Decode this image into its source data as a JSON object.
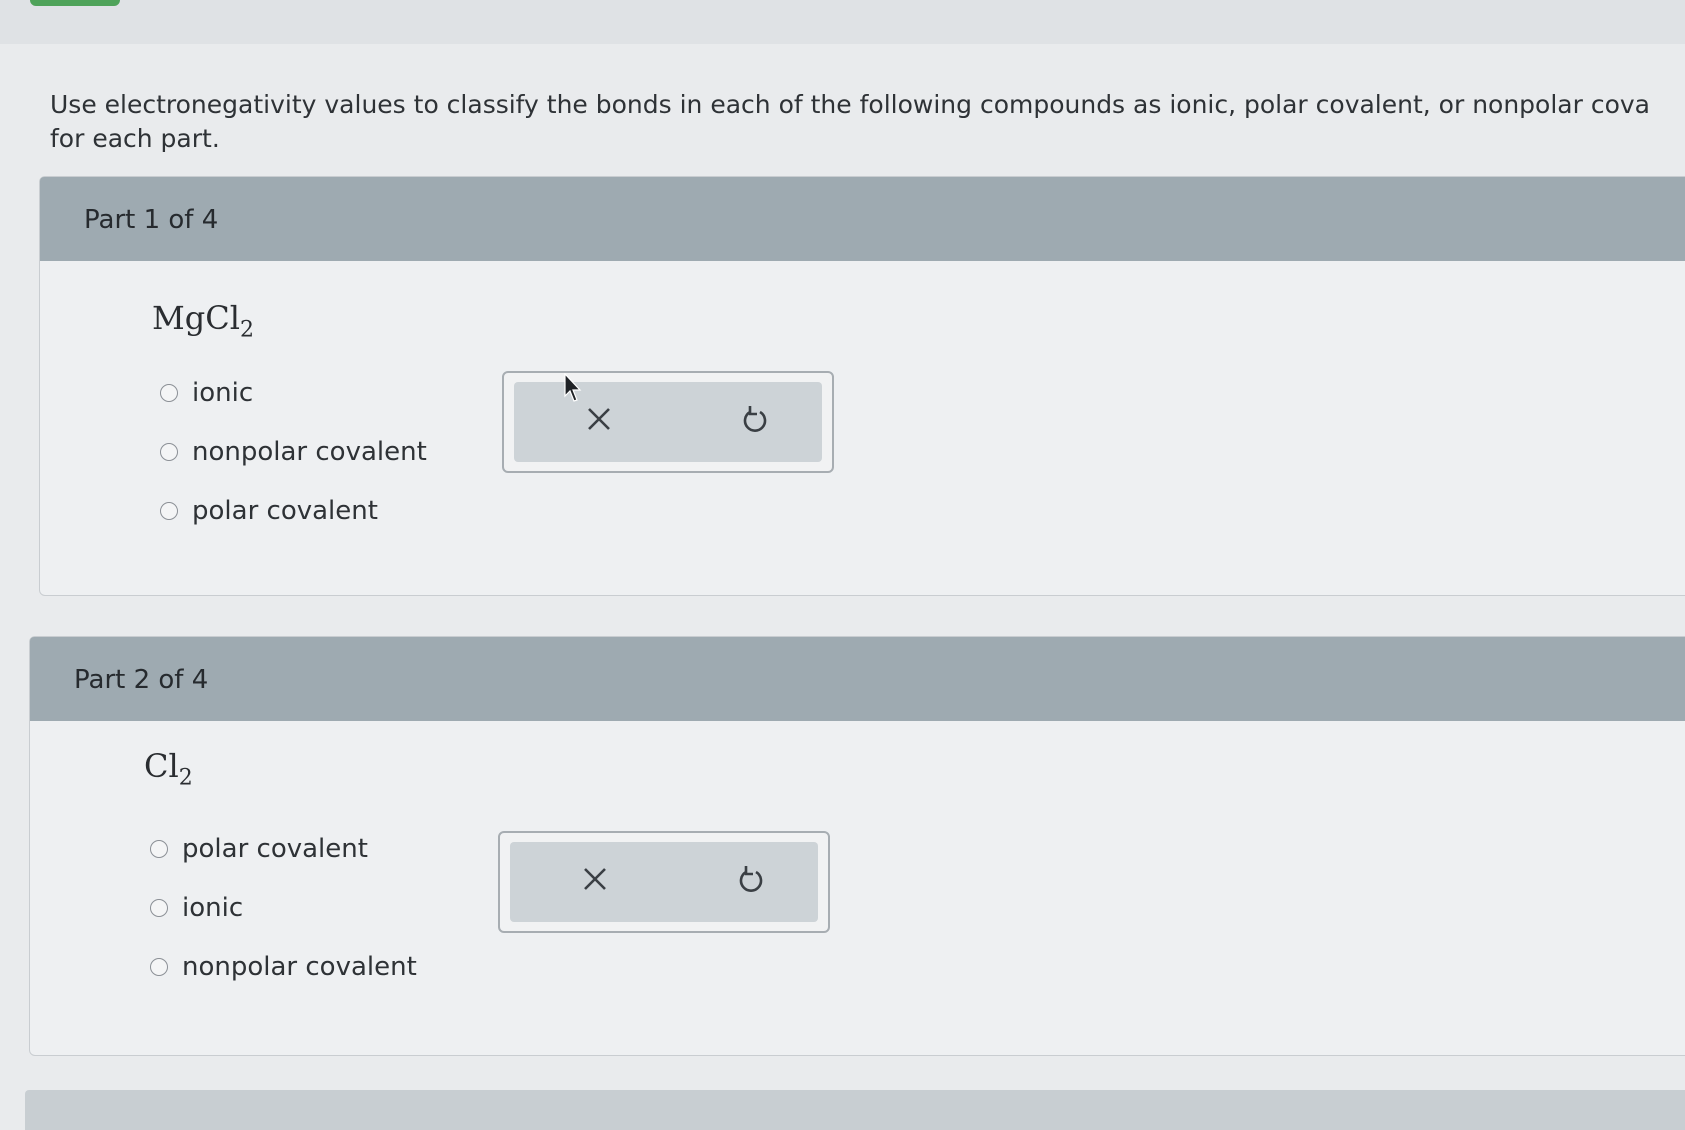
{
  "instructions": "Use electronegativity values to classify the bonds in each of the following compounds as ionic, polar covalent, or nonpolar cova",
  "instructions_line2": "for each part.",
  "parts": [
    {
      "title": "Part 1 of 4",
      "formula": {
        "base": "MgCl",
        "sub": "2"
      },
      "options": [
        "ionic",
        "nonpolar covalent",
        "polar covalent"
      ]
    },
    {
      "title": "Part 2 of 4",
      "formula": {
        "base": "Cl",
        "sub": "2"
      },
      "options": [
        "polar covalent",
        "ionic",
        "nonpolar covalent"
      ]
    }
  ],
  "tools": {
    "clear_icon": "close-x-icon",
    "reset_icon": "undo-icon"
  },
  "colors": {
    "header": "#9eaab1",
    "accent": "#4fa35a",
    "background": "#e9ebed"
  }
}
